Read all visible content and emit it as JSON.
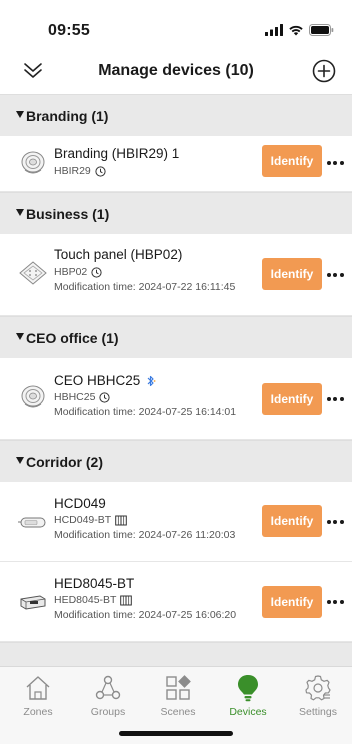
{
  "status": {
    "time": "09:55"
  },
  "header": {
    "title": "Manage devices (10)"
  },
  "groups": [
    {
      "title": "Branding (1)",
      "devices": [
        {
          "name": "Branding (HBIR29) 1",
          "model": "HBIR29",
          "model_badge": "clock-icon",
          "mod_time": "",
          "identify": "Identify"
        }
      ]
    },
    {
      "title": "Business (1)",
      "devices": [
        {
          "name": "Touch panel  (HBP02)",
          "model": "HBP02",
          "model_badge": "clock-icon",
          "mod_time": "Modification time: 2024-07-22 16:11:45",
          "identify": "Identify"
        }
      ]
    },
    {
      "title": "CEO office (1)",
      "devices": [
        {
          "name": "CEO HBHC25",
          "model": "HBHC25",
          "model_badge": "clock-icon",
          "mod_time": "Modification time: 2024-07-25 16:14:01",
          "identify": "Identify"
        }
      ]
    },
    {
      "title": "Corridor (2)",
      "devices": [
        {
          "name": "HCD049",
          "model": "HCD049-BT",
          "model_badge": "book-icon",
          "mod_time": "Modification time: 2024-07-26 11:20:03",
          "identify": "Identify"
        },
        {
          "name": "HED8045-BT",
          "model": "HED8045-BT",
          "model_badge": "book-icon",
          "mod_time": "Modification time: 2024-07-25 16:06:20",
          "identify": "Identify"
        }
      ]
    }
  ],
  "tabs": [
    {
      "label": "Zones",
      "icon": "house-icon",
      "active": false
    },
    {
      "label": "Groups",
      "icon": "groups-icon",
      "active": false
    },
    {
      "label": "Scenes",
      "icon": "scenes-icon",
      "active": false
    },
    {
      "label": "Devices",
      "icon": "bulb-icon",
      "active": true
    },
    {
      "label": "Settings",
      "icon": "gear-icon",
      "active": false
    }
  ],
  "colors": {
    "accent": "#f29a52",
    "active_tab": "#3a8f2a",
    "group_bg": "#e9e9e9",
    "bluetooth": "#3b7be0"
  }
}
